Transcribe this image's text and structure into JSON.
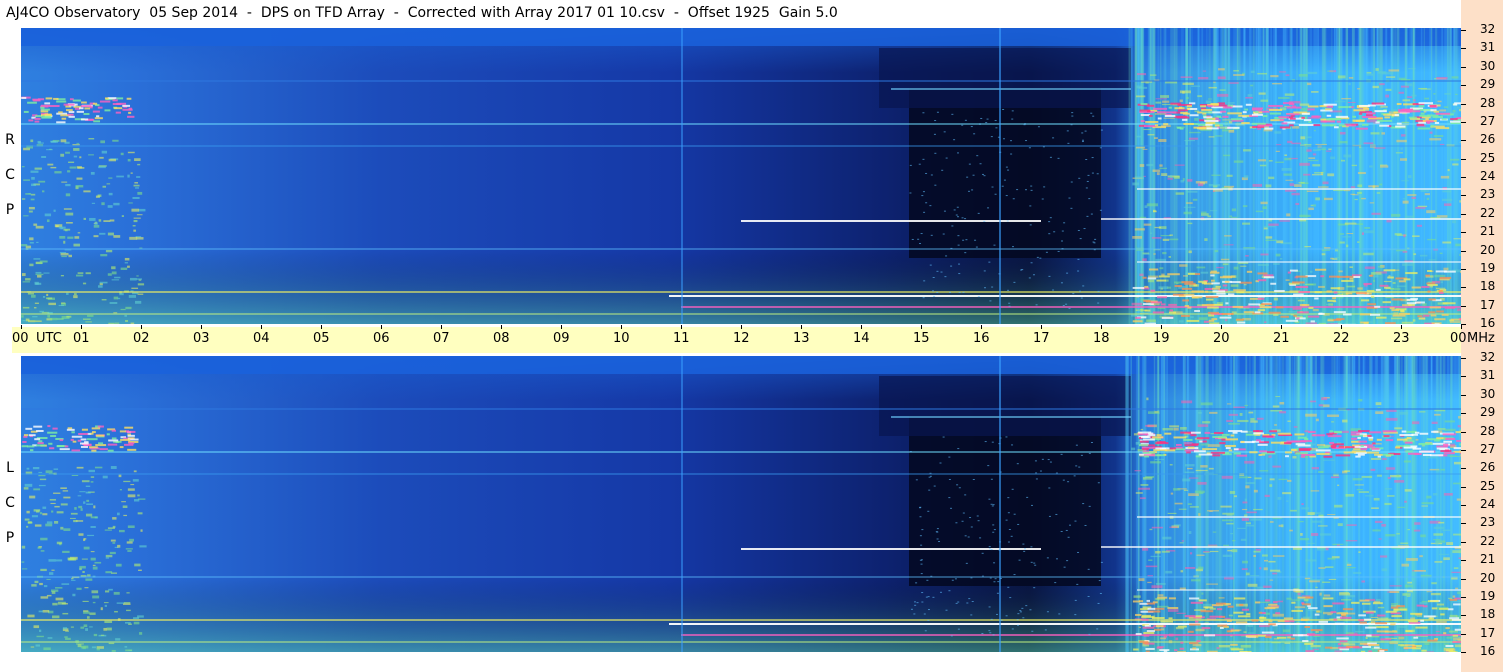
{
  "title": "AJ4CO Observatory  05 Sep 2014  -  DPS on TFD Array  -  Corrected with Array 2017 01 10.csv  -  Offset 1925  Gain 5.0",
  "chart_data": {
    "type": "heatmap",
    "title": "AJ4CO Observatory  05 Sep 2014  -  DPS on TFD Array  -  Corrected with Array 2017 01 10.csv  -  Offset 1925  Gain 5.0",
    "x_axis": {
      "unit_label": "UTC",
      "range": [
        0,
        24
      ],
      "ticks": [
        "00",
        "01",
        "02",
        "03",
        "04",
        "05",
        "06",
        "07",
        "08",
        "09",
        "10",
        "11",
        "12",
        "13",
        "14",
        "15",
        "16",
        "17",
        "18",
        "19",
        "20",
        "21",
        "22",
        "23",
        "00"
      ]
    },
    "y_axis": {
      "unit_label": "MHz",
      "range": [
        16,
        32
      ],
      "ticks": [
        32,
        31,
        30,
        29,
        28,
        27,
        26,
        25,
        24,
        23,
        22,
        21,
        20,
        19,
        18,
        17,
        16
      ]
    },
    "panels": [
      {
        "name": "RCP",
        "letters": [
          "R",
          "C",
          "P"
        ]
      },
      {
        "name": "LCP",
        "letters": [
          "L",
          "C",
          "P"
        ]
      }
    ],
    "colors": {
      "background_high": "#1a54c0",
      "deep": "#060a30",
      "band_glow": "#5ad0ff",
      "hot": "#ff40a0",
      "saturated": "#ffffff",
      "warm": "#ffe060"
    }
  }
}
